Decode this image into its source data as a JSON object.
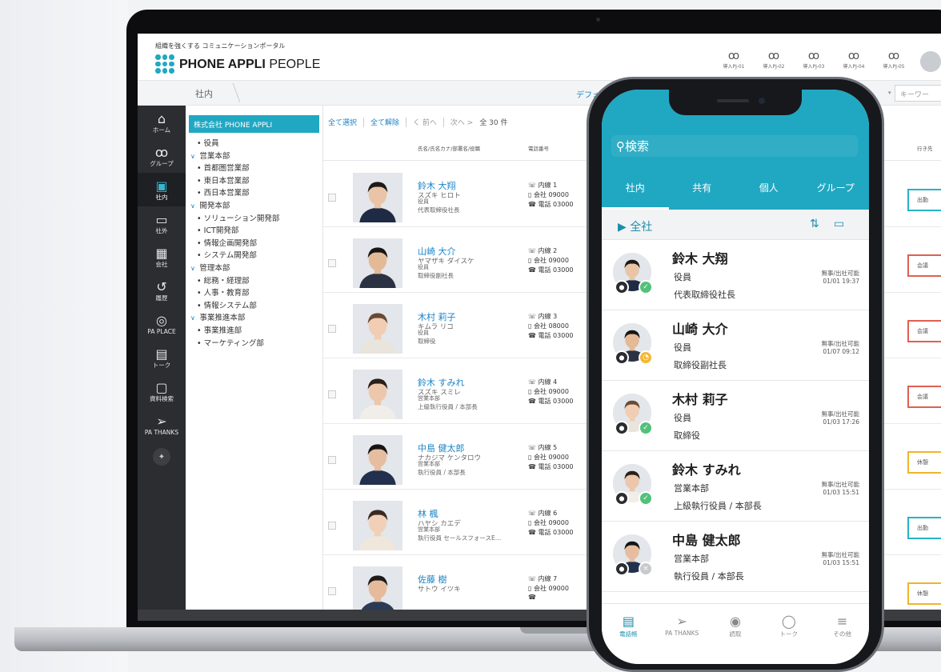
{
  "app": {
    "tagline": "組織を強くする コミュニケーションポータル",
    "brand_bold": "PHONE APPLI",
    "brand_light": "PEOPLE"
  },
  "header": {
    "icons": [
      {
        "label": "導入PJ-01",
        "icon": "people-icon"
      },
      {
        "label": "導入PJ-02",
        "icon": "people-icon"
      },
      {
        "label": "導入PJ-03",
        "icon": "people-icon"
      },
      {
        "label": "導入PJ-04",
        "icon": "people-icon"
      },
      {
        "label": "導入PJ-05",
        "icon": "people-icon"
      }
    ]
  },
  "subbar": {
    "breadcrumb": "社内",
    "default_label": "デフォ",
    "keyword_placeholder": "キーワー"
  },
  "sidebar": {
    "items": [
      {
        "label": "ホーム",
        "icon": "home-icon"
      },
      {
        "label": "グループ",
        "icon": "group-icon"
      },
      {
        "label": "社内",
        "icon": "directory-icon",
        "active": true
      },
      {
        "label": "社外",
        "icon": "card-icon"
      },
      {
        "label": "会社",
        "icon": "building-icon"
      },
      {
        "label": "履歴",
        "icon": "history-icon"
      },
      {
        "label": "PA PLACE",
        "icon": "location-icon"
      },
      {
        "label": "トーク",
        "icon": "chat-icon"
      },
      {
        "label": "資料検索",
        "icon": "document-search-icon"
      },
      {
        "label": "PA THANKS",
        "icon": "paper-plane-icon"
      }
    ]
  },
  "tree": {
    "company": "株式会社 PHONE APPLI",
    "rows": [
      {
        "label": "役員",
        "level": 2
      },
      {
        "label": "営業本部",
        "level": 1
      },
      {
        "label": "首都圏営業部",
        "level": 2
      },
      {
        "label": "東日本営業部",
        "level": 2
      },
      {
        "label": "西日本営業部",
        "level": 2
      },
      {
        "label": "開発本部",
        "level": 1
      },
      {
        "label": "ソリューション開発部",
        "level": 2
      },
      {
        "label": "ICT開発部",
        "level": 2
      },
      {
        "label": "情報企画開発部",
        "level": 2
      },
      {
        "label": "システム開発部",
        "level": 2
      },
      {
        "label": "管理本部",
        "level": 1
      },
      {
        "label": "総務・経理部",
        "level": 2
      },
      {
        "label": "人事・教育部",
        "level": 2
      },
      {
        "label": "情報システム部",
        "level": 2
      },
      {
        "label": "事業推進本部",
        "level": 1
      },
      {
        "label": "事業推進部",
        "level": 2
      },
      {
        "label": "マーケティング部",
        "level": 2
      }
    ]
  },
  "list": {
    "select_all": "全て選択",
    "clear_all": "全て解除",
    "prev": "く 前へ",
    "next": "次へ >",
    "count": "全 30 件",
    "col_name": "氏名/氏名カナ/部署名/役職",
    "col_phone": "電話番号",
    "col_dest": "行き先",
    "rows": [
      {
        "name": "鈴木 大翔",
        "kana": "スズキ ヒロト",
        "dept": "役員",
        "title": "代表取締役社長",
        "ext": "内線 1",
        "mobile": "会社 09000",
        "tel": "電話 03000",
        "status": "出勤",
        "status_color": "#26b3c9"
      },
      {
        "name": "山崎 大介",
        "kana": "ヤマザキ ダイスケ",
        "dept": "役員",
        "title": "取締役副社長",
        "ext": "内線 2",
        "mobile": "会社 09000",
        "tel": "電話 03000",
        "status": "会議",
        "status_color": "#e06050"
      },
      {
        "name": "木村 莉子",
        "kana": "キムラ リコ",
        "dept": "役員",
        "title": "取締役",
        "ext": "内線 3",
        "mobile": "会社 08000",
        "tel": "電話 03000",
        "status": "会議",
        "status_color": "#e06050"
      },
      {
        "name": "鈴木 すみれ",
        "kana": "スズキ スミレ",
        "dept": "営業本部",
        "title": "上級執行役員 / 本部長",
        "ext": "内線 4",
        "mobile": "会社 09000",
        "tel": "電話 03000",
        "status": "会議",
        "status_color": "#e06050"
      },
      {
        "name": "中島 健太郎",
        "kana": "ナカジマ ケンタロウ",
        "dept": "営業本部",
        "title": "執行役員 / 本部長",
        "ext": "内線 5",
        "mobile": "会社 09000",
        "tel": "電話 03000",
        "status": "休憩",
        "status_color": "#f0b429"
      },
      {
        "name": "林 楓",
        "kana": "ハヤシ カエデ",
        "dept": "営業本部",
        "title": "執行役員 セールスフォースE…",
        "ext": "内線 6",
        "mobile": "会社 09000",
        "tel": "電話 03000",
        "status": "出勤",
        "status_color": "#26b3c9"
      },
      {
        "name": "佐藤 樹",
        "kana": "サトウ イツキ",
        "dept": "",
        "title": "",
        "ext": "内線 7",
        "mobile": "会社 09000",
        "tel": "",
        "status": "休憩",
        "status_color": "#f0b429"
      }
    ]
  },
  "phone": {
    "search": "検索",
    "tabs": [
      "社内",
      "共有",
      "個人",
      "グループ"
    ],
    "crumb": "全社",
    "rows": [
      {
        "name": "鈴木 大翔",
        "line2": "役員",
        "line3": "代表取締役社長",
        "s1": "無事/出社可能",
        "s2": "01/01 19:37",
        "st_color": "#52c17a",
        "st_glyph": "✓"
      },
      {
        "name": "山崎 大介",
        "line2": "役員",
        "line3": "取締役副社長",
        "s1": "無事/出社可能",
        "s2": "01/07 09:12",
        "st_color": "#f5b733",
        "st_glyph": "◔"
      },
      {
        "name": "木村 莉子",
        "line2": "役員",
        "line3": "取締役",
        "s1": "無事/出社可能",
        "s2": "01/03 17:26",
        "st_color": "#52c17a",
        "st_glyph": "✓"
      },
      {
        "name": "鈴木 すみれ",
        "line2": "営業本部",
        "line3": "上級執行役員 / 本部長",
        "s1": "無事/出社可能",
        "s2": "01/03 15:51",
        "st_color": "#52c17a",
        "st_glyph": "✓"
      },
      {
        "name": "中島 健太郎",
        "line2": "営業本部",
        "line3": "執行役員 / 本部長",
        "s1": "無事/出社可能",
        "s2": "01/03 15:51",
        "st_color": "#c7c9cd",
        "st_glyph": "×"
      }
    ],
    "nav": [
      {
        "label": "電話帳",
        "icon": "phonebook-icon",
        "active": true
      },
      {
        "label": "PA THANKS",
        "icon": "paper-plane-icon"
      },
      {
        "label": "読取",
        "icon": "camera-icon"
      },
      {
        "label": "トーク",
        "icon": "chat-bubble-icon"
      },
      {
        "label": "その他",
        "icon": "menu-icon"
      }
    ]
  }
}
